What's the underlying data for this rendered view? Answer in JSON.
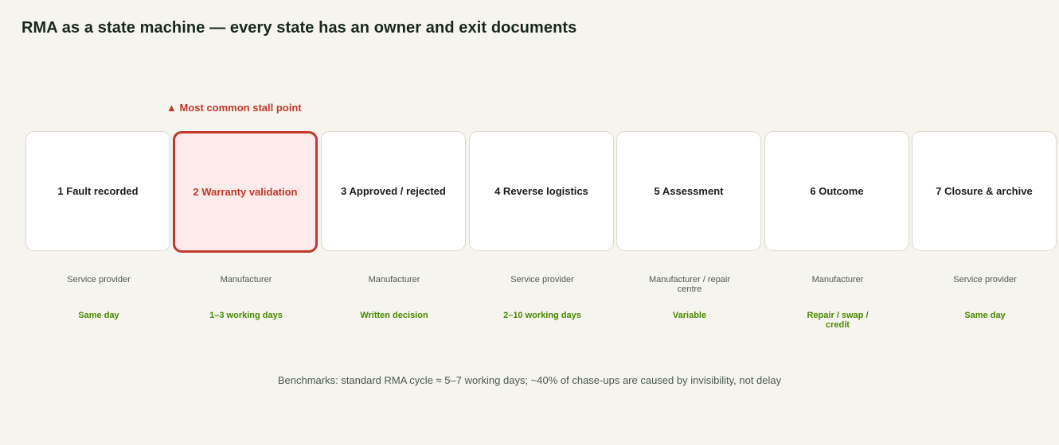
{
  "title": "RMA as a state machine — every state has an owner and exit documents",
  "stall_marker": {
    "icon": "triangle-up-icon",
    "glyph": "▲",
    "label": "Most common stall point",
    "color": "#c0392b"
  },
  "stages": [
    {
      "label": "1 Fault recorded",
      "owner": "Service provider",
      "timing": "Same day"
    },
    {
      "label": "2 Warranty validation",
      "owner": "Manufacturer",
      "timing": "1–3 working days",
      "highlighted": true
    },
    {
      "label": "3 Approved / rejected",
      "owner": "Manufacturer",
      "timing": "Written decision"
    },
    {
      "label": "4 Reverse logistics",
      "owner": "Service provider",
      "timing": "2–10 working days"
    },
    {
      "label": "5 Assessment",
      "owner": "Manufacturer / repair centre",
      "timing": "Variable"
    },
    {
      "label": "6 Outcome",
      "owner": "Manufacturer",
      "timing": "Repair / swap / credit"
    },
    {
      "label": "7 Closure & archive",
      "owner": "Service provider",
      "timing": "Same day"
    }
  ],
  "footer": "Benchmarks: standard RMA cycle ≈ 5–7 working days; ~40% of chase-ups are caused by invisibility, not delay",
  "colors": {
    "background": "#f6f4ee",
    "highlight": "#c0392b",
    "timing": "#4a8a00"
  }
}
